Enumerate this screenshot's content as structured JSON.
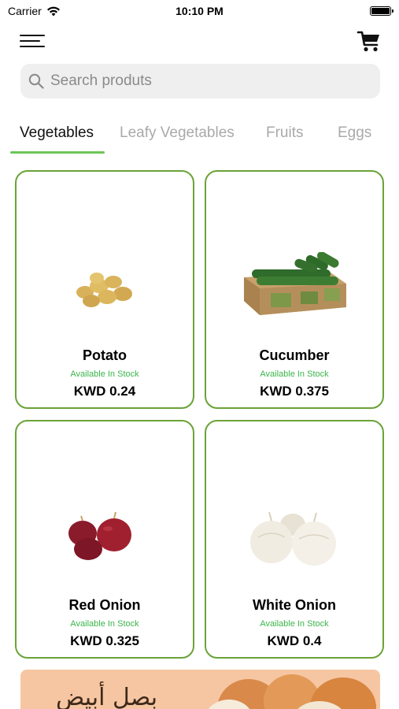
{
  "status_bar": {
    "carrier": "Carrier",
    "time": "10:10 PM",
    "wifi_icon": "wifi-icon",
    "battery_icon": "battery-icon"
  },
  "header": {
    "menu_icon": "hamburger-menu-icon",
    "cart_icon": "shopping-cart-icon"
  },
  "search": {
    "placeholder": "Search produts",
    "value": "",
    "icon": "search-icon"
  },
  "tabs": [
    {
      "label": "Vegetables",
      "active": true
    },
    {
      "label": "Leafy Vegetables",
      "active": false
    },
    {
      "label": "Fruits",
      "active": false
    },
    {
      "label": "Eggs",
      "active": false
    }
  ],
  "products": [
    {
      "name": "Potato",
      "stock": "Available In Stock",
      "price": "KWD 0.24",
      "image": "potato-image"
    },
    {
      "name": "Cucumber",
      "stock": "Available In Stock",
      "price": "KWD 0.375",
      "image": "cucumber-box-image"
    },
    {
      "name": "Red Onion",
      "stock": "Available In Stock",
      "price": "KWD 0.325",
      "image": "red-onion-image"
    },
    {
      "name": "White Onion",
      "stock": "Available In Stock",
      "price": "KWD 0.4",
      "image": "white-onion-image"
    }
  ],
  "banner": {
    "text": "بصل أبيض"
  },
  "colors": {
    "accent_green": "#6cc65a",
    "card_border": "#6aa338",
    "stock_green": "#3ab54a",
    "search_bg": "#efefef"
  }
}
